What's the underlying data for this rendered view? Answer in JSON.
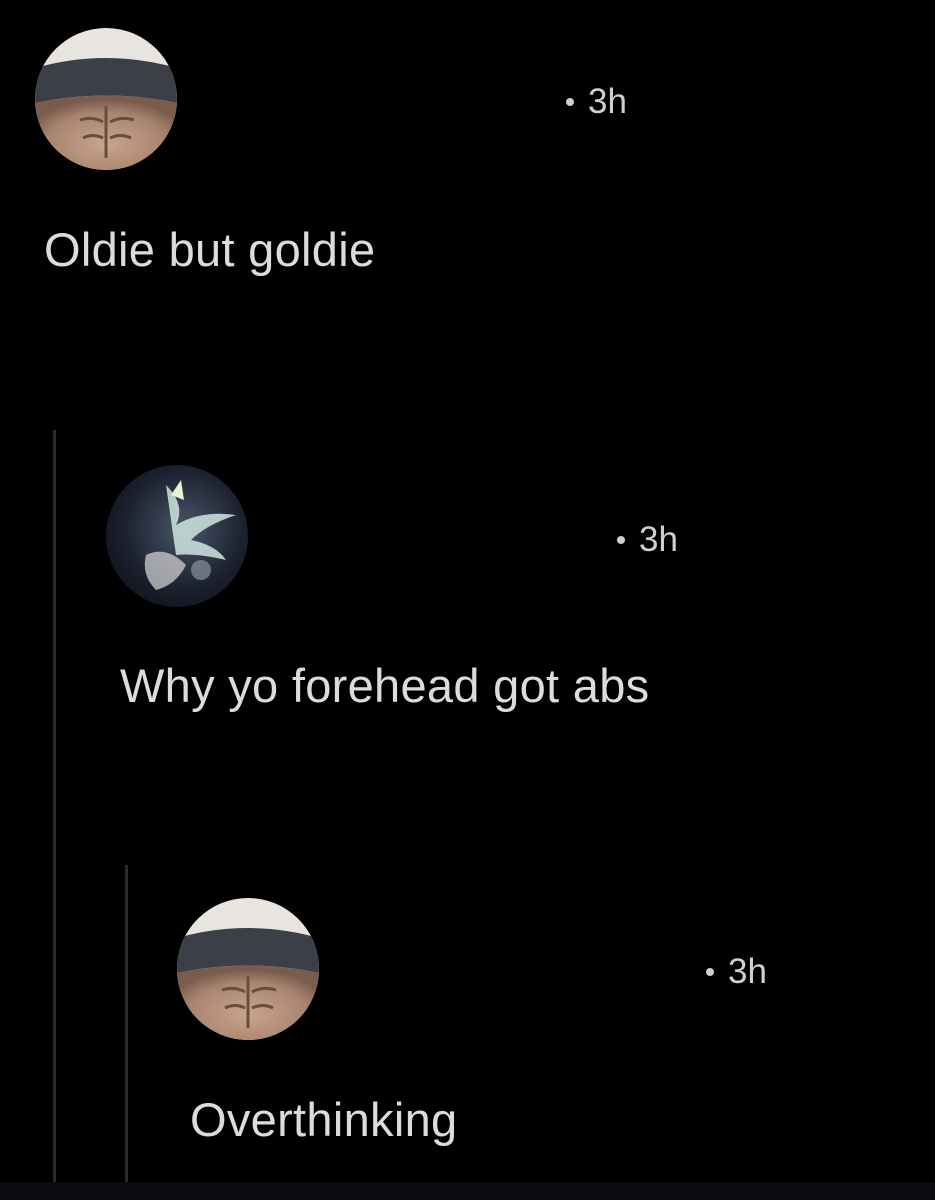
{
  "comments": [
    {
      "username": "",
      "timestamp": "3h",
      "text": "Oldie but goldie",
      "avatar_icon": "abs-forehead-avatar-icon"
    },
    {
      "username": "",
      "timestamp": "3h",
      "text": "Why yo forehead got abs",
      "avatar_icon": "anime-character-avatar-icon"
    },
    {
      "username": "",
      "timestamp": "3h",
      "text": "Overthinking",
      "avatar_icon": "abs-forehead-avatar-icon"
    }
  ],
  "colors": {
    "background": "#000000",
    "text": "#dcdcdc",
    "thread_line": "#2b2b2b"
  }
}
